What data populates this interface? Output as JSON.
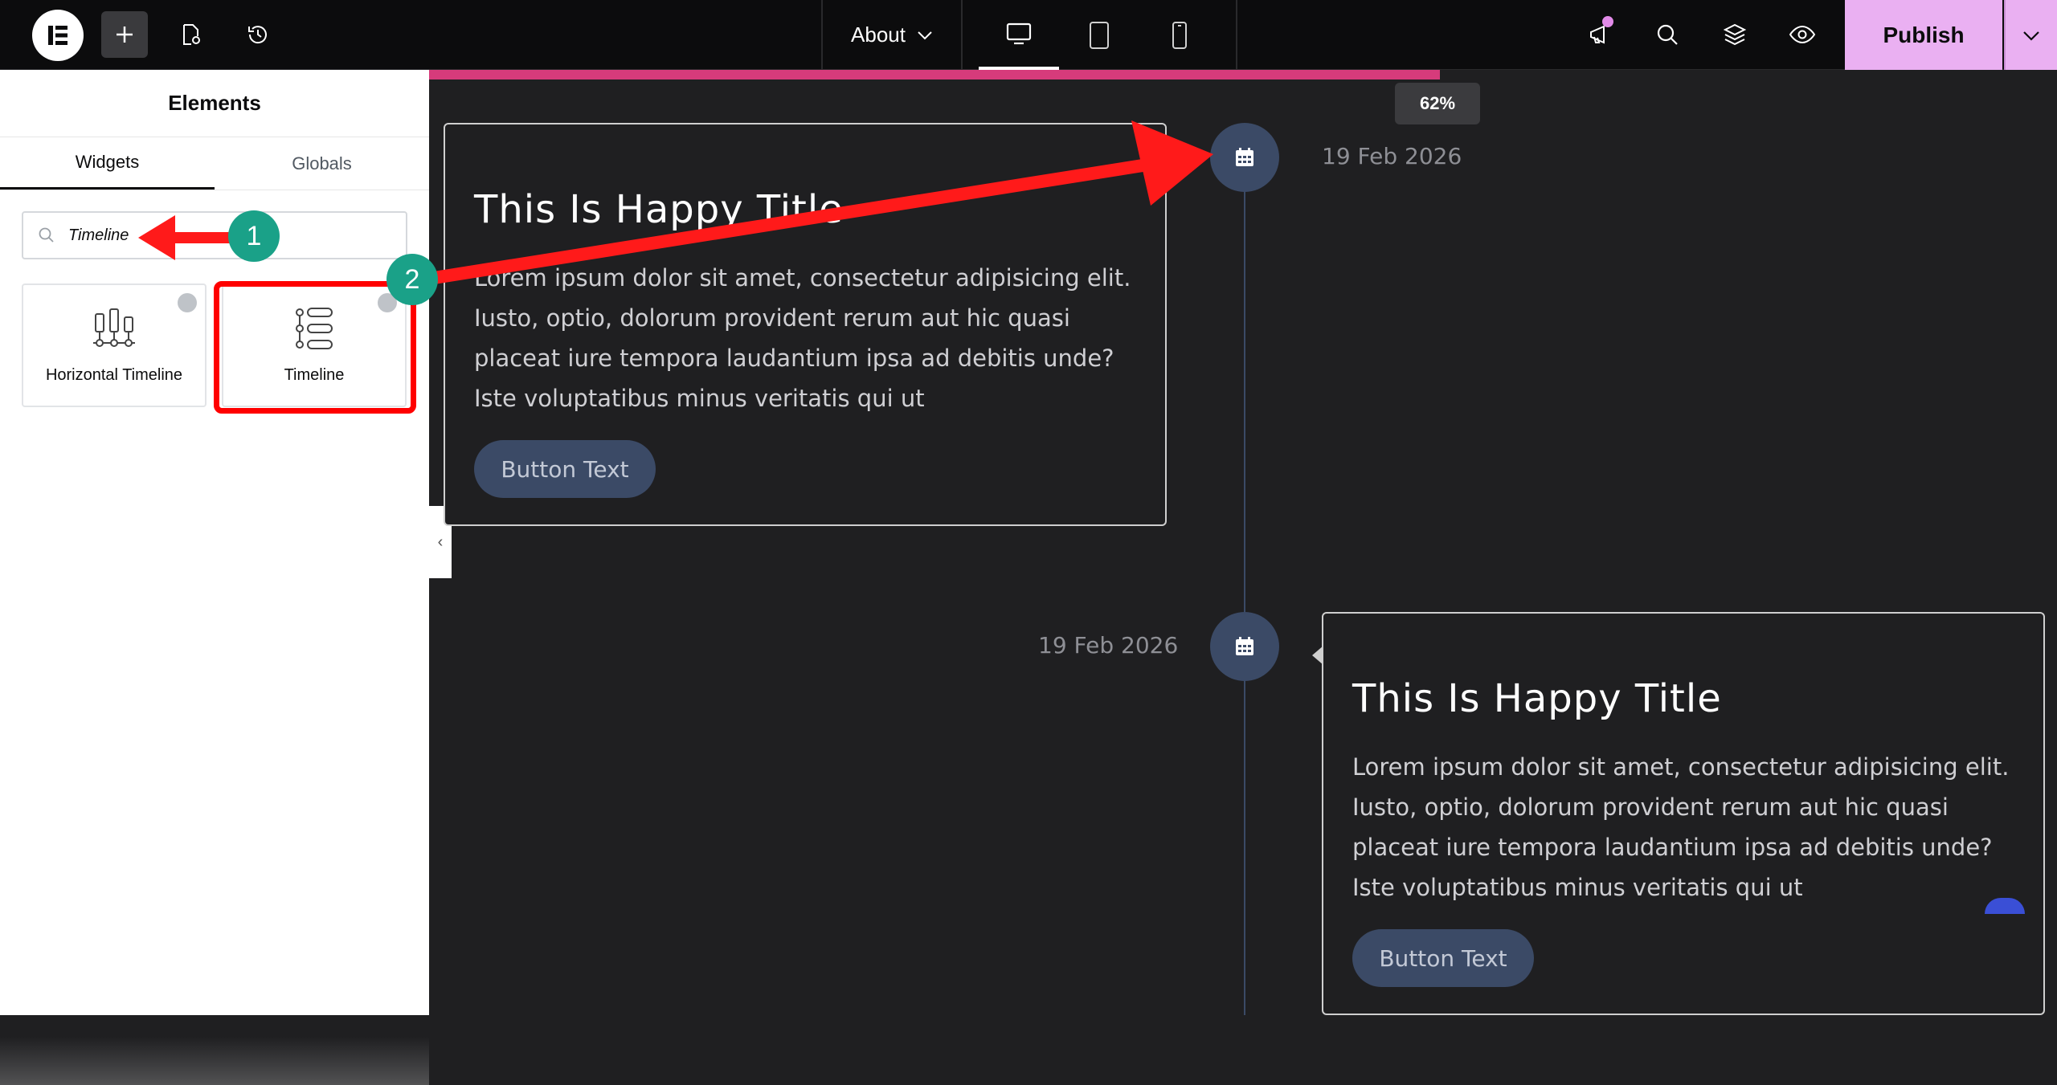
{
  "topbar": {
    "page_selector": "About",
    "publish_label": "Publish",
    "icons": [
      "elementor-logo-icon",
      "plus-icon",
      "page-settings-icon",
      "history-icon",
      "desktop-icon",
      "tablet-icon",
      "mobile-icon",
      "megaphone-icon",
      "search-icon",
      "layers-icon",
      "eye-icon",
      "chevron-down-icon"
    ]
  },
  "panel": {
    "title": "Elements",
    "tabs": [
      "Widgets",
      "Globals"
    ],
    "search": {
      "value": "Timeline"
    },
    "widgets": [
      {
        "label": "Horizontal Timeline",
        "icon": "horizontal-timeline-icon"
      },
      {
        "label": "Timeline",
        "icon": "timeline-icon"
      }
    ]
  },
  "canvas": {
    "progress_percent": 62,
    "progress_label": "62%",
    "progress_color": "#d63b7b",
    "items": [
      {
        "title": "This Is Happy Title",
        "body": "Lorem ipsum dolor sit amet, consectetur adipisicing elit. Iusto, optio, dolorum provident rerum aut hic quasi placeat iure tempora laudantium ipsa ad debitis unde? Iste voluptatibus minus veritatis qui ut",
        "button": "Button Text",
        "date": "19 Feb 2026"
      },
      {
        "title": "This Is Happy Title",
        "body": "Lorem ipsum dolor sit amet, consectetur adipisicing elit. Iusto, optio, dolorum provident rerum aut hic quasi placeat iure tempora laudantium ipsa ad debitis unde? Iste voluptatibus minus veritatis qui ut",
        "button": "Button Text",
        "date": "19 Feb 2026"
      }
    ]
  },
  "annotations": {
    "step1": "1",
    "step2": "2",
    "highlight_color": "#ff0000",
    "badge_color": "#1aa188"
  }
}
